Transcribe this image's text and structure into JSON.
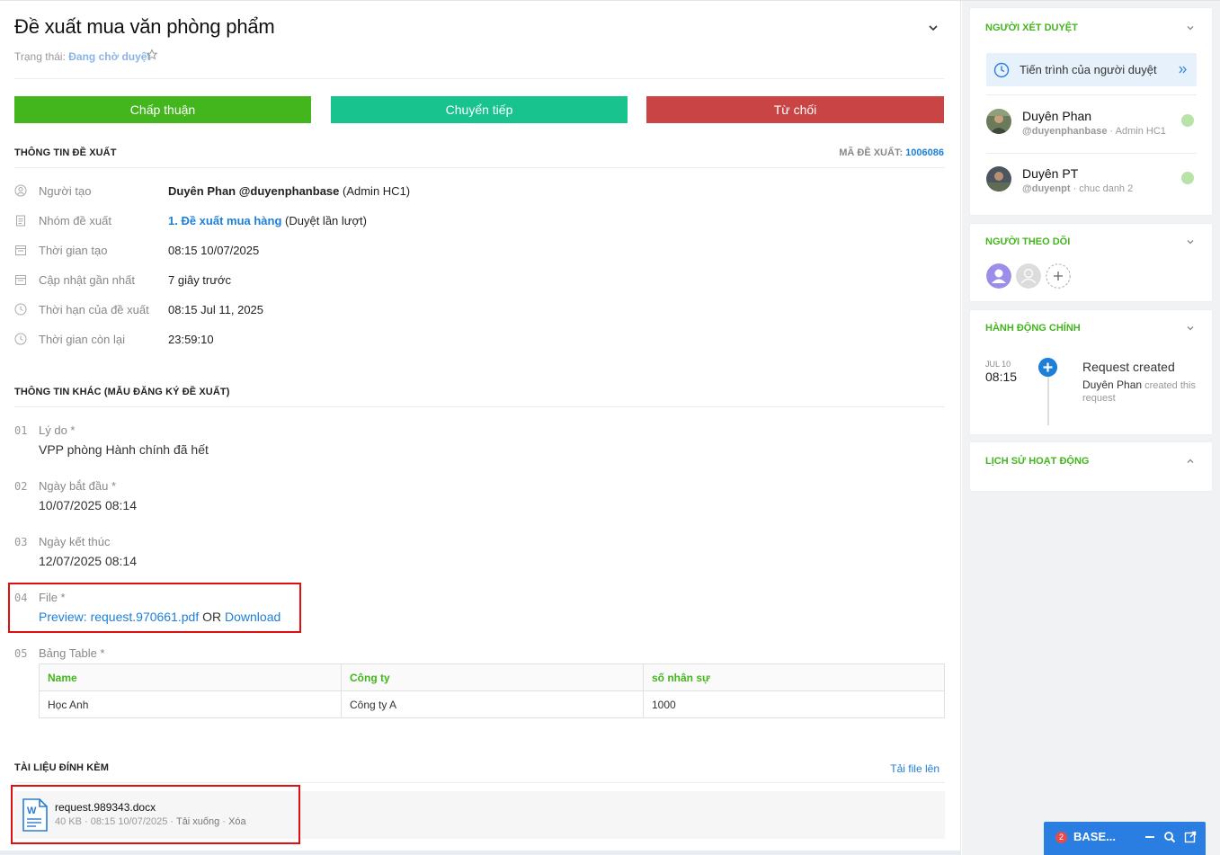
{
  "header": {
    "title": "Đề xuất mua văn phòng phẩm",
    "status_label": "Trạng thái:",
    "status_value": "Đang chờ duyệt"
  },
  "actions": {
    "approve": "Chấp thuận",
    "forward": "Chuyển tiếp",
    "reject": "Từ chối"
  },
  "proposal_info": {
    "section_title": "THÔNG TIN ĐỀ XUẤT",
    "code_label": "MÃ ĐỀ XUẤT:",
    "code_value": "1006086",
    "rows": [
      {
        "label": "Người tạo",
        "value_strong": "Duyên Phan @duyenphanbase",
        "value_rest": " (Admin HC1)"
      },
      {
        "label": "Nhóm đề xuất",
        "value_link": "1. Đề xuất mua hàng",
        "value_rest": " (Duyệt lần lượt)"
      },
      {
        "label": "Thời gian tạo",
        "value": "08:15 10/07/2025"
      },
      {
        "label": "Cập nhật gần nhất",
        "value": "7 giây trước"
      },
      {
        "label": "Thời hạn của đề xuất",
        "value": "08:15 Jul 11, 2025"
      },
      {
        "label": "Thời gian còn lại",
        "value": "23:59:10"
      }
    ]
  },
  "other_info": {
    "section_title": "THÔNG TIN KHÁC (MẪU ĐĂNG KÝ ĐỀ XUẤT)",
    "fields": [
      {
        "num": "01",
        "label": "Lý do *",
        "value": "VPP phòng Hành chính đã hết"
      },
      {
        "num": "02",
        "label": "Ngày bắt đầu *",
        "value": "10/07/2025 08:14"
      },
      {
        "num": "03",
        "label": "Ngày kết thúc",
        "value": "12/07/2025 08:14"
      },
      {
        "num": "04",
        "label": "File *",
        "preview": "Preview: request.970661.pdf",
        "or": " OR ",
        "download": "Download"
      },
      {
        "num": "05",
        "label": "Bảng Table *"
      }
    ],
    "table": {
      "headers": [
        "Name",
        "Công ty",
        "số nhân sự"
      ],
      "rows": [
        [
          "Học Anh",
          "Công ty A",
          "1000"
        ]
      ]
    }
  },
  "attachments": {
    "section_title": "TÀI LIỆU ĐÍNH KÈM",
    "upload_label": "Tải file lên",
    "file": {
      "name": "request.989343.docx",
      "meta": "40 KB · 08:15 10/07/2025 · ",
      "download": "Tải xuống",
      "sep": " · ",
      "delete": "Xóa"
    }
  },
  "sidebar": {
    "reviewers": {
      "title": "NGƯỜI XÉT DUYỆT",
      "progress_label": "Tiến trình của người duyệt",
      "people": [
        {
          "name": "Duyên Phan",
          "username": "@duyenphanbase",
          "role": " · Admin HC1"
        },
        {
          "name": "Duyên PT",
          "username": "@duyenpt",
          "role": " · chuc danh 2"
        }
      ]
    },
    "followers": {
      "title": "NGƯỜI THEO DÕI"
    },
    "main_actions": {
      "title": "HÀNH ĐỘNG CHÍNH",
      "month": "JUL 10",
      "time": "08:15",
      "event": "Request created",
      "actor": "Duyên Phan",
      "detail": " created this request"
    },
    "history": {
      "title": "LỊCH SỬ HOẠT ĐỘNG"
    }
  },
  "widget": {
    "badge": "2",
    "title": "BASE..."
  },
  "colors": {
    "approve": "#43b51d",
    "forward": "#18c38d",
    "reject": "#c94545",
    "accent": "#1e7fd8",
    "highlight_box": "#e01010"
  }
}
